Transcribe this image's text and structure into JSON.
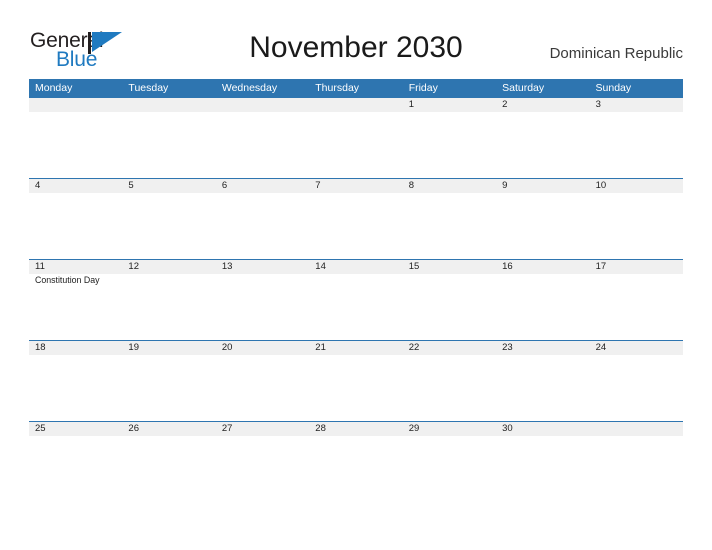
{
  "brand": {
    "name_part1": "General",
    "name_part2": "Blue",
    "logo_icon": "general-blue-triangle-logo",
    "accent_color": "#1f7ac0"
  },
  "header": {
    "title": "November 2030",
    "country": "Dominican Republic"
  },
  "calendar": {
    "header_bg_color": "#2e75b0",
    "daynum_band_color": "#f0f0f0",
    "weekdays": [
      "Monday",
      "Tuesday",
      "Wednesday",
      "Thursday",
      "Friday",
      "Saturday",
      "Sunday"
    ],
    "weeks": [
      [
        {
          "day": ""
        },
        {
          "day": ""
        },
        {
          "day": ""
        },
        {
          "day": ""
        },
        {
          "day": "1"
        },
        {
          "day": "2"
        },
        {
          "day": "3"
        }
      ],
      [
        {
          "day": "4"
        },
        {
          "day": "5"
        },
        {
          "day": "6"
        },
        {
          "day": "7"
        },
        {
          "day": "8"
        },
        {
          "day": "9"
        },
        {
          "day": "10"
        }
      ],
      [
        {
          "day": "11",
          "event": "Constitution Day"
        },
        {
          "day": "12"
        },
        {
          "day": "13"
        },
        {
          "day": "14"
        },
        {
          "day": "15"
        },
        {
          "day": "16"
        },
        {
          "day": "17"
        }
      ],
      [
        {
          "day": "18"
        },
        {
          "day": "19"
        },
        {
          "day": "20"
        },
        {
          "day": "21"
        },
        {
          "day": "22"
        },
        {
          "day": "23"
        },
        {
          "day": "24"
        }
      ],
      [
        {
          "day": "25"
        },
        {
          "day": "26"
        },
        {
          "day": "27"
        },
        {
          "day": "28"
        },
        {
          "day": "29"
        },
        {
          "day": "30"
        },
        {
          "day": ""
        }
      ]
    ]
  }
}
